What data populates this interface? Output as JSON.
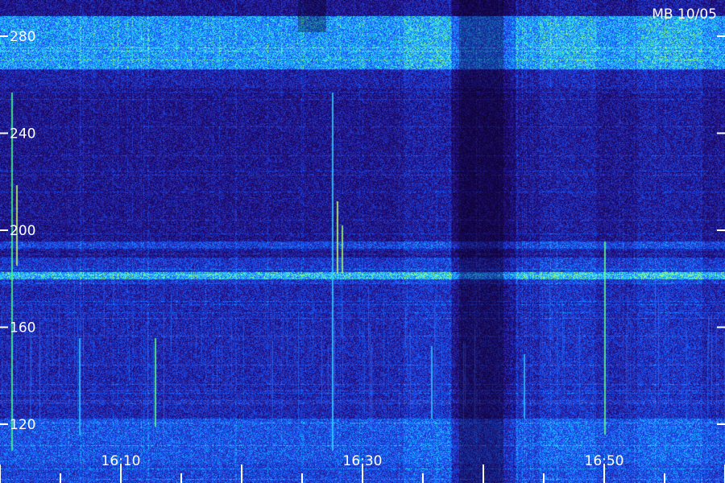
{
  "title": "MB 10/05",
  "chart_data": {
    "type": "heatmap",
    "title": "MB 10/05",
    "xlabel": "",
    "ylabel": "",
    "x_ticks": [
      {
        "label": "16:10",
        "minute": 10
      },
      {
        "label": "16:30",
        "minute": 30
      },
      {
        "label": "16:50",
        "minute": 50
      }
    ],
    "y_ticks": [
      {
        "label": "280",
        "value": 280
      },
      {
        "label": "240",
        "value": 240
      },
      {
        "label": "200",
        "value": 200
      },
      {
        "label": "160",
        "value": 160
      },
      {
        "label": "120",
        "value": 120
      }
    ],
    "colors": {
      "background": "#12063a",
      "low": "#2a10a0",
      "mid": "#2440ff",
      "high": "#20d8ff",
      "peak": "#a0ff60",
      "tick": "#ffffff",
      "text": "#ffffff"
    },
    "grid": false,
    "legend": "none"
  }
}
